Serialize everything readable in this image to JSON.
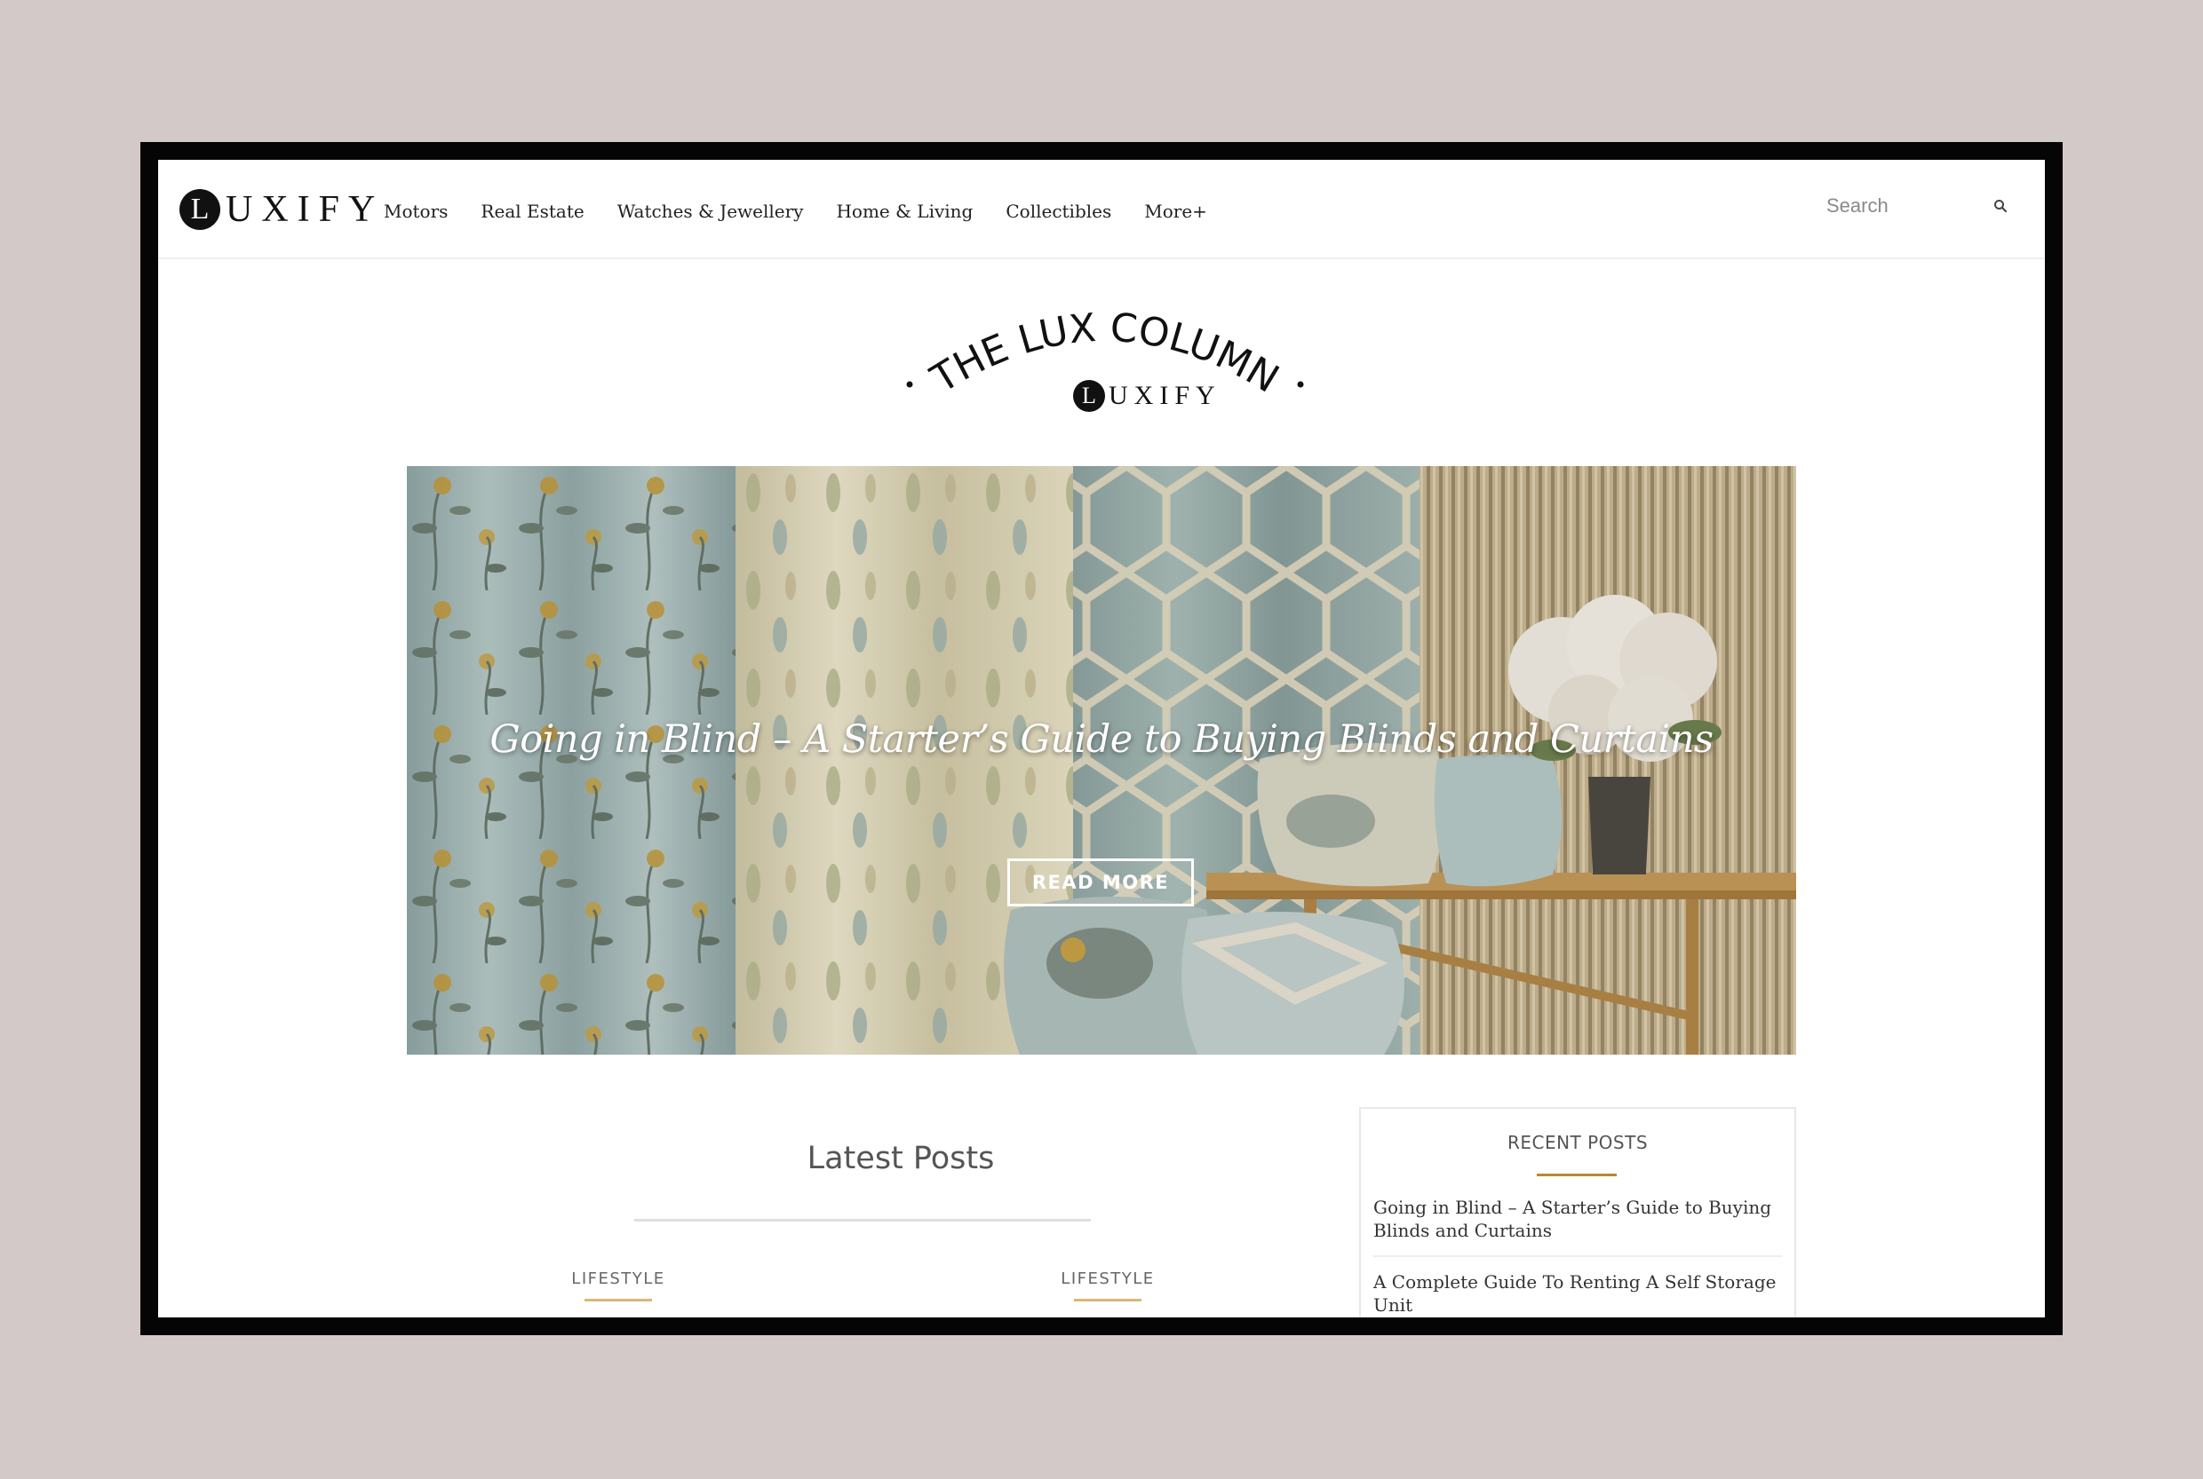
{
  "header": {
    "logo_letter": "L",
    "logo_text": "UXIFY",
    "nav": [
      "Motors",
      "Real Estate",
      "Watches & Jewellery",
      "Home & Living",
      "Collectibles",
      "More+"
    ],
    "search_placeholder": "Search"
  },
  "column_logo": {
    "title": "THE LUX COLUMN",
    "brand_letter": "L",
    "brand_text": "UXIFY"
  },
  "hero": {
    "title": "Going in Blind – A Starter’s Guide to Buying Blinds and Curtains",
    "button_label": "READ MORE"
  },
  "latest_posts": {
    "title": "Latest Posts",
    "categories": [
      "LIFESTYLE",
      "LIFESTYLE"
    ]
  },
  "sidebar": {
    "title": "RECENT POSTS",
    "items": [
      "Going in Blind – A Starter’s Guide to Buying Blinds and Curtains",
      "A Complete Guide To Renting A Self Storage Unit"
    ]
  },
  "colors": {
    "accent_gold": "#b58a2e",
    "background": "#d4c9c9",
    "frame": "#050505"
  }
}
